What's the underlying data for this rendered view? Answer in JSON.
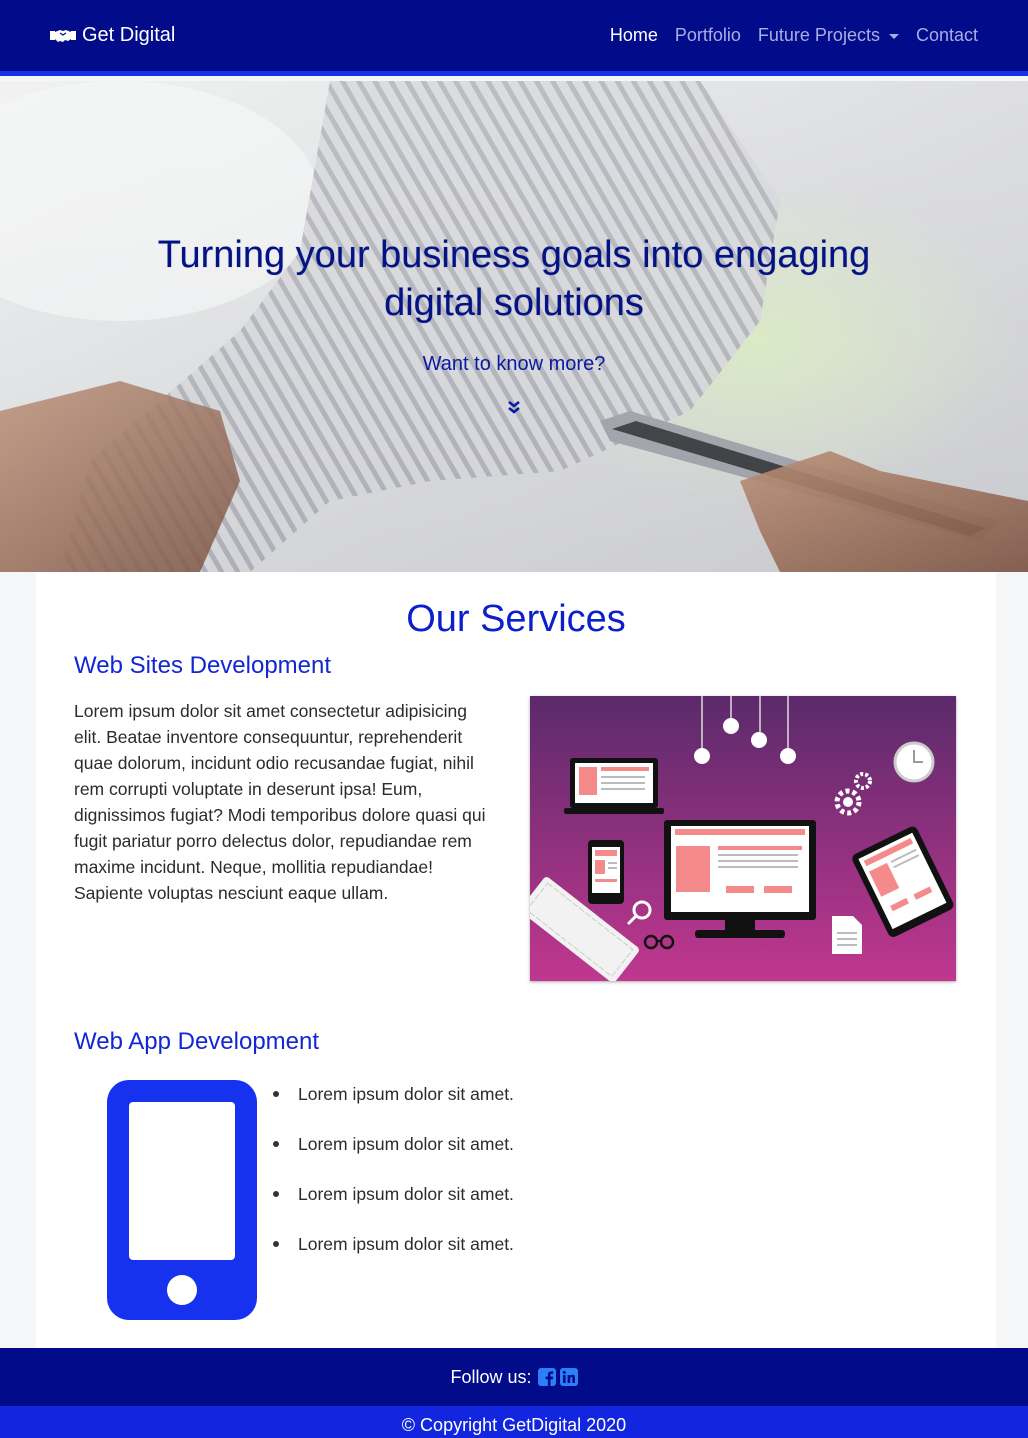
{
  "navbar": {
    "brand": "Get Digital",
    "links": [
      {
        "label": "Home",
        "active": true
      },
      {
        "label": "Portfolio",
        "active": false
      },
      {
        "label": "Future Projects",
        "active": false
      },
      {
        "label": "Contact",
        "active": false
      }
    ],
    "brand_icon": "handshake-icon"
  },
  "hero": {
    "title": "Turning your business goals into engaging digital solutions",
    "subtitle": "Want to know more?",
    "arrow_icon": "double-chevron-down-icon"
  },
  "services": {
    "heading": "Our Services",
    "web_sites": {
      "title": "Web Sites Development",
      "text": "Lorem ipsum dolor sit amet consectetur adipisicing elit. Beatae inventore consequuntur, reprehenderit quae dolorum, incidunt odio recusandae fugiat, nihil rem corrupti voluptate in deserunt ipsa! Eum, dignissimos fugiat? Modi temporibus dolore quasi qui fugit pariatur porro delectus dolor, repudiandae rem maxime incidunt. Neque, mollitia repudiandae! Sapiente voluptas nesciunt eaque ullam."
    },
    "web_app": {
      "title": "Web App Development",
      "items": [
        "Lorem ipsum dolor sit amet.",
        "Lorem ipsum dolor sit amet.",
        "Lorem ipsum dolor sit amet.",
        "Lorem ipsum dolor sit amet."
      ],
      "icon": "mobile-phone-icon"
    }
  },
  "footer": {
    "follow_label": "Follow us:",
    "social_icons": [
      "facebook-icon",
      "linkedin-icon"
    ],
    "copyright": "© Copyright GetDigital 2020"
  },
  "colors": {
    "navbar_bg": "#020b8a",
    "accent": "#1226e0",
    "heading_blue": "#0b1fcc"
  }
}
